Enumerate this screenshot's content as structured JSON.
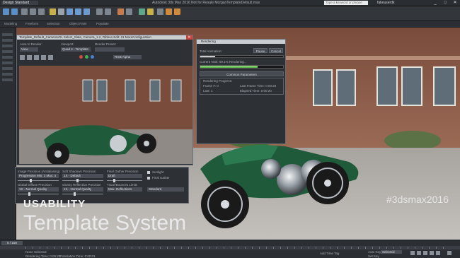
{
  "titlebar": {
    "workspace": "Design Standard",
    "app_title": "Autodesk 3ds Max 2016   Not for Resale   MorganTemplateDefault.max",
    "help_search": "Type a keyword or phrase",
    "user": "fakeuserdk",
    "window_buttons": [
      "_",
      "□",
      "✕"
    ]
  },
  "ribbon": [
    "Modeling",
    "Freeform",
    "Selection",
    "Object Paint",
    "Populate"
  ],
  "material_editor": {
    "title": "Template_Default_CameraV01   Select_Slate, Camera_1.2, Ribbon Edit: 01 MoreConfiguration",
    "labels": [
      "Area to Render:",
      "Viewport:",
      "Render Preset:"
    ],
    "area_value": "View",
    "viewport_value": "Quad 4 - Template",
    "preset_value": "",
    "channel_value": "RGB Alpha",
    "close": "✕"
  },
  "render_dialog": {
    "title": "Rendering",
    "total_animation": "Total Animation:",
    "current_task": "Current Task:   69.1%  Rendering...",
    "progress_fraction": 0.69,
    "total_progress_fraction": 0.18,
    "pause": "Pause",
    "cancel": "Cancel",
    "common_parameters": "Common Parameters",
    "rendering_progress": "Rendering Progress:",
    "frame_label": "Frame #: 0",
    "last_frame_time": "Last Frame Time: 0:00:20",
    "pass_label": "Last: 1",
    "elapsed_time": "Elapsed Time: 0:00:20"
  },
  "parameters": {
    "col1_title": "Image Precision (Antialiasing)",
    "col1_row1": "Progressive  Min: 1  Max: 4",
    "col1_title2": "Global Diffuse Precision",
    "col1_row2": "1X - Normal Quality",
    "col2_title": "Soft Shadows Precision",
    "col2_row1": "1X - Default",
    "col2_title2": "Glossy Reflection Precision",
    "col2_row2": "1X - Normal Quality",
    "col3_title": "Final Gather Precision",
    "col3_row1": "Draft",
    "col3_title2": "Trace/Bounces Limits",
    "col3_row2": "Max. Reflections",
    "check1": "Sunlight",
    "check2": "Final Gather",
    "dropdown": "Standard"
  },
  "overlay": {
    "usability": "USABILITY",
    "template_system": "Template System",
    "hashtag": "#3dsmax2016"
  },
  "timeline": {
    "frame": "0 / 100",
    "add_time_tag": "Add Time Tag",
    "selected": "Selected",
    "auto_key": "Auto Key",
    "set_key": "Set Key"
  },
  "status": {
    "none_selected": "None Selected",
    "rendering_time": "Rendering Time: 0:00:20",
    "translation_time": "Translation Time: 0:00:01"
  },
  "colors": {
    "accent_progress": "#6fcf5a",
    "brick": "#8a5a47",
    "car_green": "#1f5a3a"
  }
}
